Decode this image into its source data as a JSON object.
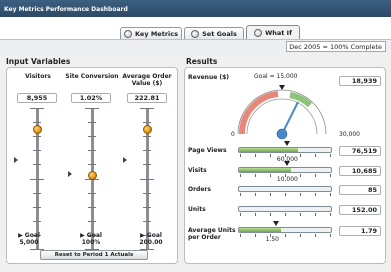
{
  "app": {
    "title": "Key Metrics Performance Dashboard"
  },
  "tabs": [
    {
      "label": "Key Metrics",
      "active": false
    },
    {
      "label": "Set Goals",
      "active": false
    },
    {
      "label": "What If",
      "active": true
    }
  ],
  "date_status": "Dec 2005 = 100% Complete",
  "input_variables": {
    "title": "Input Variables",
    "columns": [
      {
        "label": "Visitors",
        "value": "8,955",
        "goal": "▶ Goal\n5,000",
        "goal_label": "▶ Goal",
        "goal_value": "5,000",
        "level": 0.79
      },
      {
        "label": "Site Conversion",
        "value": "1.02%",
        "goal_label": "▶ Goal",
        "goal_value": "100%",
        "level": 0.34
      },
      {
        "label": "Average Order Value ($)",
        "value": "222.81",
        "goal_label": "▶ Goal",
        "goal_value": "200.00",
        "level": 0.79
      }
    ],
    "reset_label": "Reset to Period 1 Actuals"
  },
  "results": {
    "title": "Results",
    "revenue_label": "Revenue ($)",
    "gauge": {
      "min_label": "0",
      "max_label": "30,000",
      "goal_text": "Goal = 15,000",
      "value": "18,939",
      "min": 0,
      "max": 30000,
      "goal": 15000,
      "current": 18939
    },
    "rows": [
      {
        "label": "Page Views",
        "value": "76,519",
        "goal_text": "60,000",
        "level": 0.64,
        "goal_level": 0.52
      },
      {
        "label": "Visits",
        "value": "10,685",
        "goal_text": "10,000",
        "level": 0.56,
        "goal_level": 0.52
      },
      {
        "label": "Orders",
        "value": "85",
        "goal_text": "",
        "level": 0.0,
        "goal_level": null
      },
      {
        "label": "Units",
        "value": "152.00",
        "goal_text": "",
        "level": 0.0,
        "goal_level": null
      },
      {
        "label": "Average Units per Order",
        "value": "1.79",
        "goal_text": "1.50",
        "level": 0.46,
        "goal_level": 0.4
      }
    ]
  },
  "colors": {
    "titlebar": "#2c4a66",
    "gauge_red": "#e8887a",
    "gauge_green": "#8fc27a",
    "needle": "#4a88c8",
    "bar_green": "#7bb356",
    "knob": "#f0a020"
  }
}
